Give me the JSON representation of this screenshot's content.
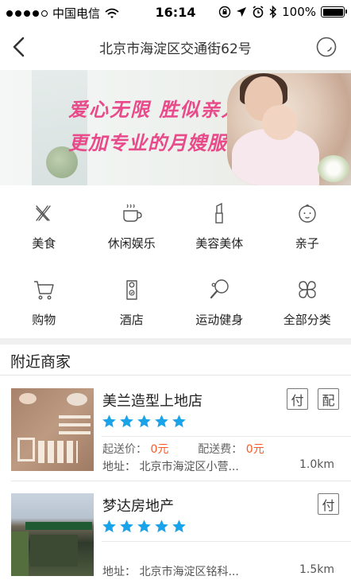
{
  "status_bar": {
    "carrier": "中国电信",
    "time": "16:14",
    "battery": "100%"
  },
  "nav": {
    "title": "北京市海淀区交通街62号"
  },
  "banner": {
    "line1": "爱心无限  胜似亲人",
    "line2": "更加专业的月嫂服务"
  },
  "categories": [
    {
      "label": "美食",
      "icon": "food-icon"
    },
    {
      "label": "休闲娱乐",
      "icon": "coffee-icon"
    },
    {
      "label": "美容美体",
      "icon": "lipstick-icon"
    },
    {
      "label": "亲子",
      "icon": "baby-icon"
    },
    {
      "label": "购物",
      "icon": "cart-icon"
    },
    {
      "label": "酒店",
      "icon": "door-hanger-icon"
    },
    {
      "label": "运动健身",
      "icon": "ping-pong-icon"
    },
    {
      "label": "全部分类",
      "icon": "clover-icon"
    }
  ],
  "nearby": {
    "title": "附近商家"
  },
  "merchants": [
    {
      "name": "美兰造型上地店",
      "rating": 5,
      "badges": [
        "付",
        "配"
      ],
      "min_order_label": "起送价：",
      "min_order_value": "0元",
      "delivery_fee_label": "配送费：",
      "delivery_fee_value": "0元",
      "address": "地址： 北京市海淀区小营...",
      "distance": "1.0km"
    },
    {
      "name": "梦达房地产",
      "rating": 5,
      "badges": [
        "付"
      ],
      "address": "地址： 北京市海淀区铭科...",
      "distance": "1.5km"
    }
  ],
  "colors": {
    "accent_blue": "#1aa3e8",
    "price_red": "#ff5722",
    "banner_pink": "#e84a8a"
  }
}
